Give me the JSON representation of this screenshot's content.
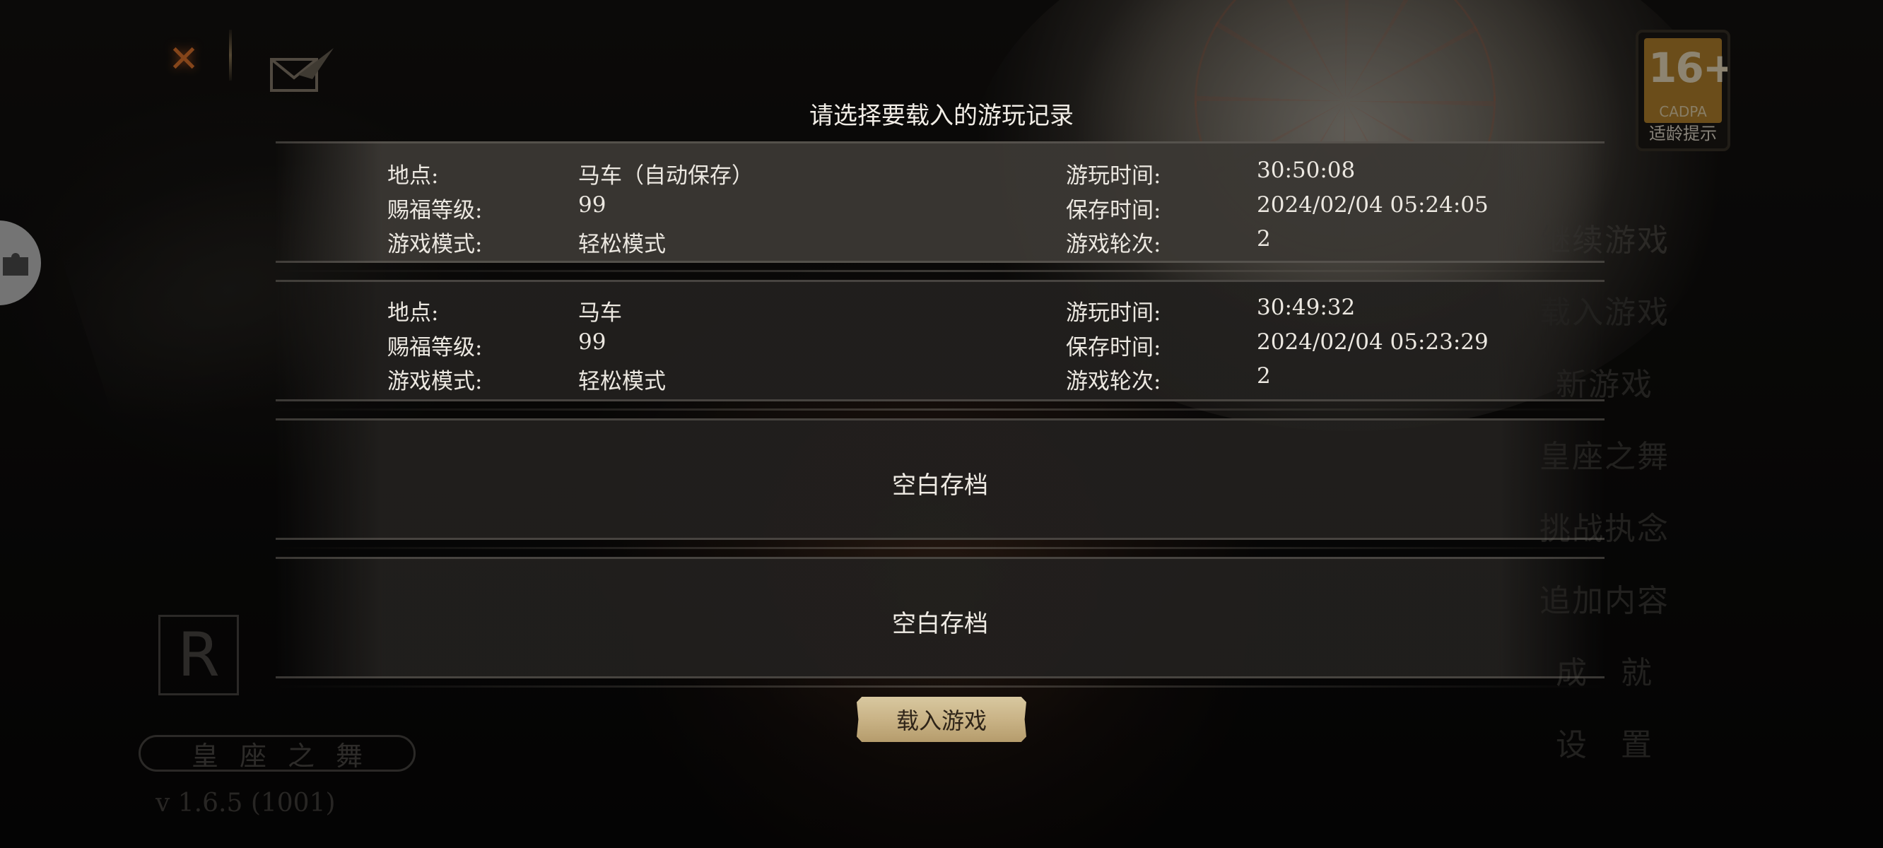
{
  "header": {
    "close_icon": "crossed-swords-icon",
    "mail_icon": "envelope-quill-icon"
  },
  "age_badge": {
    "rating": "16+",
    "org": "CADPA",
    "hint": "适龄提示"
  },
  "menu": {
    "items": [
      "继续游戏",
      "载入游戏",
      "新游戏",
      "皇座之舞",
      "挑战执念",
      "追加内容",
      "成　就",
      "设　置"
    ]
  },
  "branding": {
    "logo_letter": "R",
    "game_title": "皇座之舞",
    "version": "v 1.6.5 (1001)"
  },
  "dialog": {
    "title": "请选择要载入的游玩记录",
    "labels": {
      "location": "地点:",
      "level": "赐福等级:",
      "mode": "游戏模式:",
      "playtime": "游玩时间:",
      "savetime": "保存时间:",
      "round": "游戏轮次:"
    },
    "slots": [
      {
        "location": "马车（自动保存）",
        "level": "99",
        "mode": "轻松模式",
        "playtime": "30:50:08",
        "savetime": "2024/02/04 05:24:05",
        "round": "2"
      },
      {
        "location": "马车",
        "level": "99",
        "mode": "轻松模式",
        "playtime": "30:49:32",
        "savetime": "2024/02/04 05:23:29",
        "round": "2"
      }
    ],
    "empty_slots": [
      "空白存档",
      "空白存档"
    ],
    "load_button": "载入游戏"
  }
}
